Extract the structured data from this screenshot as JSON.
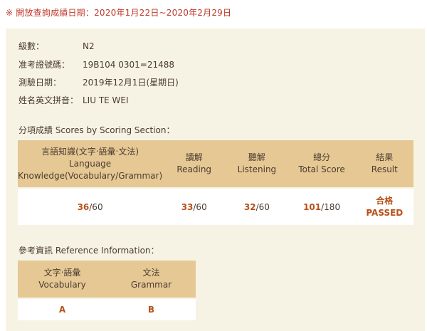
{
  "notice": "※ 開放查詢成績日期：2020年1月22日~2020年2月29日",
  "info": [
    {
      "label": "級數：",
      "value": "N2"
    },
    {
      "label": "准考證號碼：",
      "value": "19B104 0301=21488"
    },
    {
      "label": "測驗日期：",
      "value": "2019年12月1日(星期日)"
    },
    {
      "label": "姓名英文拼音：",
      "value": "LIU TE WEI"
    }
  ],
  "scores_section": {
    "title": "分項成績 Scores by Scoring Section：",
    "headers": [
      {
        "line1": "言語知識(文字‧語彙‧文法)",
        "line2": "Language",
        "line3": "Knowledge(Vocabulary/Grammar)"
      },
      {
        "line1": "讀解",
        "line2": "Reading"
      },
      {
        "line1": "聽解",
        "line2": "Listening"
      },
      {
        "line1": "總分",
        "line2": "Total Score"
      },
      {
        "line1": "結果",
        "line2": "Result"
      }
    ],
    "values": [
      {
        "score": "36",
        "max": "/60"
      },
      {
        "score": "33",
        "max": "/60"
      },
      {
        "score": "32",
        "max": "/60"
      },
      {
        "score": "101",
        "max": "/180"
      }
    ],
    "result_zh": "合格",
    "result_en": "PASSED"
  },
  "reference_section": {
    "title": "參考資訊 Reference Information：",
    "headers": [
      {
        "line1": "文字‧語彙",
        "line2": "Vocabulary"
      },
      {
        "line1": "文法",
        "line2": "Grammar"
      }
    ],
    "values": [
      "A",
      "B"
    ]
  }
}
